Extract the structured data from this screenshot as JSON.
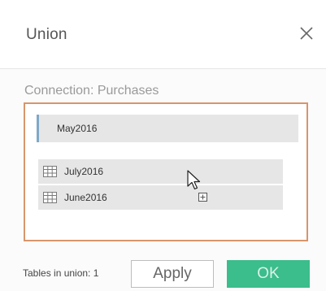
{
  "dialog": {
    "title": "Union",
    "close_icon": "close-icon"
  },
  "connection": {
    "label": "Connection: Purchases"
  },
  "union_tables": [
    {
      "name": "May2016"
    }
  ],
  "drag_tables": [
    {
      "name": "July2016",
      "icon": "table-grid-icon"
    },
    {
      "name": "June2016",
      "icon": "table-grid-icon"
    }
  ],
  "footer": {
    "tables_in_union": "Tables in union: 1",
    "apply_label": "Apply",
    "ok_label": "OK"
  },
  "colors": {
    "drop_zone_border": "#d8956b",
    "selected_indicator": "#7ea9c6",
    "ok_button": "#3bbd8c"
  }
}
